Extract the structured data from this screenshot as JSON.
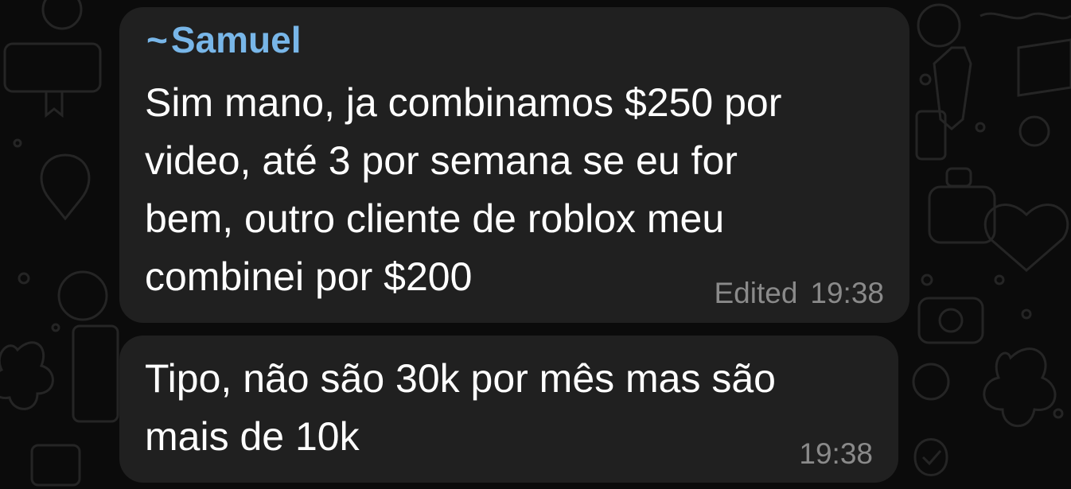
{
  "theme": {
    "background": "#0b0b0b",
    "bubble_color": "#202020",
    "text_color": "#ffffff",
    "sender_color": "#78b6e8",
    "meta_color": "#8a8a8a",
    "wallpaper_stroke": "#252525"
  },
  "messages": [
    {
      "sender_prefix": "~",
      "sender_name": "Samuel",
      "lines": [
        "Sim mano, ja combinamos $250 por",
        "video, até 3 por semana se eu for",
        "bem, outro cliente de roblox meu",
        "combinei por $200"
      ],
      "edited_label": "Edited",
      "time": "19:38"
    },
    {
      "lines": [
        "Tipo, não são 30k por mês mas são",
        "mais de 10k"
      ],
      "time": "19:38"
    }
  ]
}
